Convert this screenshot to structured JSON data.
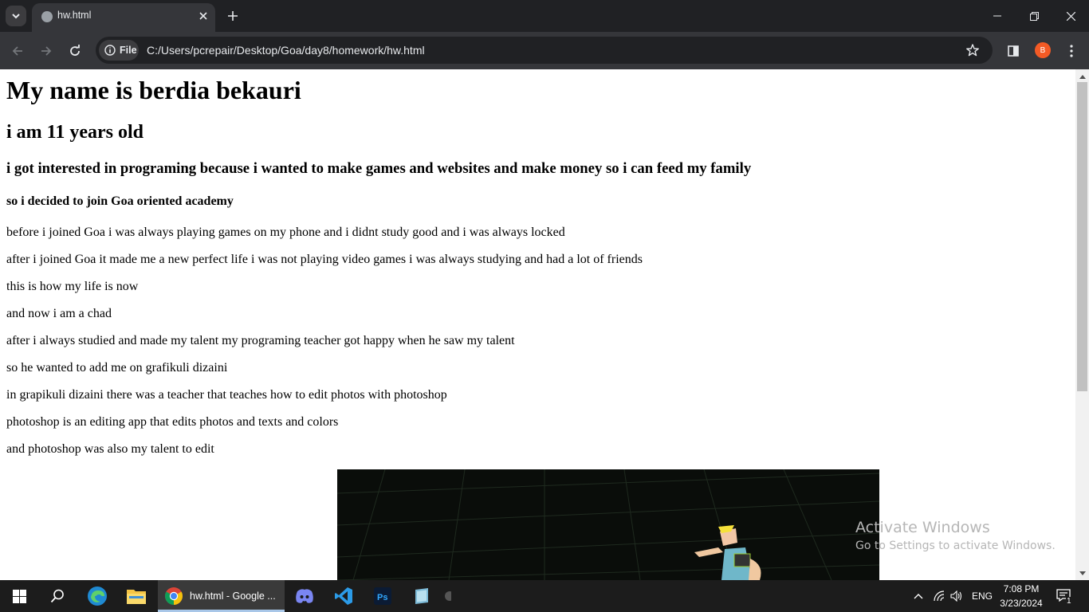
{
  "browser": {
    "tab": {
      "title": "hw.html"
    },
    "address": {
      "chip_label": "File",
      "url": "C:/Users/pcrepair/Desktop/Goa/day8/homework/hw.html"
    },
    "profile_initial": "B"
  },
  "page": {
    "h1": "My name is berdia bekauri",
    "h2": "i am 11 years old",
    "h3": "i got interested in programing because i wanted to make games and websites and make money so i can feed my family",
    "h4": "so i decided to join Goa oriented academy",
    "paragraphs": [
      "before i joined Goa i was always playing games on my phone and i didnt study good and i was always locked",
      "after i joined Goa it made me a new perfect life i was not playing video games i was always studying and had a lot of friends",
      "this is how my life is now",
      "and now i am a chad",
      "after i always studied and made my talent my programing teacher got happy when he saw my talent",
      "so he wanted to add me on grafikuli dizaini",
      "in grapikuli dizaini there was a teacher that teaches how to edit photos with photoshop",
      "photoshop is an editing app that edits photos and texts and colors",
      "and photoshop was also my talent to edit"
    ]
  },
  "watermark": {
    "title": "Activate Windows",
    "subtitle": "Go to Settings to activate Windows."
  },
  "taskbar": {
    "chrome_label": "hw.html - Google ...",
    "language": "ENG",
    "time": "7:08 PM",
    "date": "3/23/2024",
    "notification_count": "1"
  },
  "colors": {
    "tabstrip": "#202124",
    "toolbar": "#35363a",
    "omnibox": "#202124",
    "profile_avatar": "#f35a25",
    "taskbar": "#1c1c1c",
    "active_task_underline": "#a9c7e8"
  }
}
